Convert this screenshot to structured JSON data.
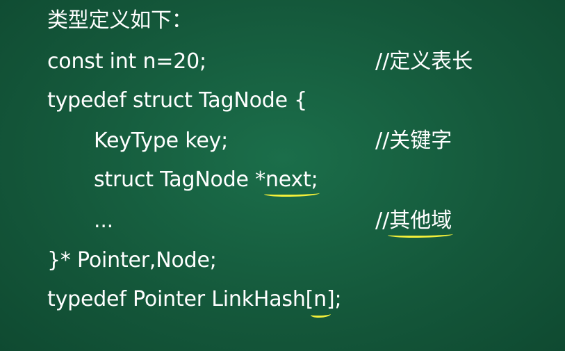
{
  "slide": {
    "title": "类型定义如下：",
    "code_lines": [
      {
        "pre": "const int n=20;",
        "comment": "//定义表长"
      },
      {
        "pre": "typedef struct TagNode {"
      },
      {
        "pre": "KeyType key;",
        "comment": "//关键字"
      },
      {
        "pre": "struct TagNode *",
        "mark": "next;",
        "post": ""
      },
      {
        "pre": "...",
        "comment_prefix": "//",
        "comment_mark": "其他域"
      },
      {
        "pre": "}* Pointer,Node;"
      },
      {
        "pre": "typedef Pointer LinkHash[",
        "mark": "n",
        "post": "];"
      }
    ]
  },
  "colors": {
    "background": "#14573a",
    "text": "#ffffff",
    "annotation": "#f3ef3a"
  }
}
